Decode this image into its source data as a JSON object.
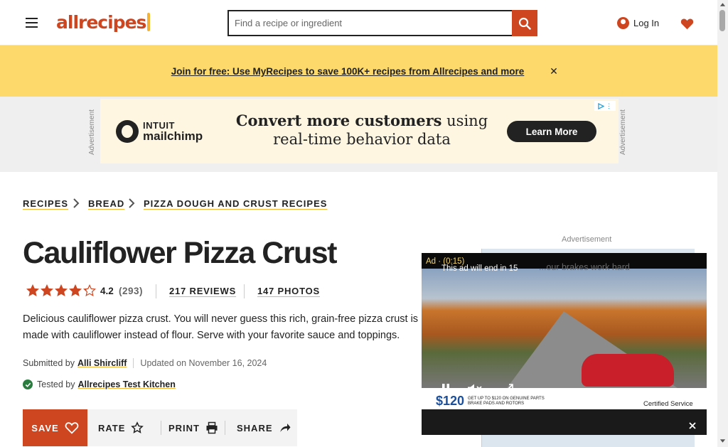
{
  "header": {
    "logo_text": "allrecipes",
    "search_placeholder": "Find a recipe or ingredient",
    "login_label": "Log In"
  },
  "promo": {
    "link_text": "Join for free: Use MyRecipes to save 100K+ recipes from Allrecipes and more",
    "close_label": "✕"
  },
  "ad": {
    "side_label": "Advertisement",
    "brand_line1": "INTUIT",
    "brand_line2": "mailchimp",
    "headline_bold": "Convert more customers",
    "headline_rest": " using real-time behavior data",
    "cta": "Learn More"
  },
  "breadcrumb": [
    {
      "label": "RECIPES"
    },
    {
      "label": "BREAD"
    },
    {
      "label": "PIZZA DOUGH AND CRUST RECIPES"
    }
  ],
  "recipe": {
    "title": "Cauliflower Pizza Crust",
    "rating_value": "4.2",
    "rating_stars": 4.2,
    "rating_count": "(293)",
    "reviews_label": "217 REVIEWS",
    "photos_label": "147 PHOTOS",
    "description": "Delicious cauliflower pizza crust. You will never guess this rich, grain-free pizza crust is made with cauliflower instead of flour. Serve with your favorite sauce and toppings.",
    "submitted_prefix": "Submitted by",
    "author": "Alli Shircliff",
    "updated": "Updated on November 16, 2024",
    "tested_prefix": "Tested by",
    "tested_by": "Allrecipes Test Kitchen"
  },
  "actions": {
    "save": "SAVE",
    "rate": "RATE",
    "print": "PRINT",
    "share": "SHARE"
  },
  "video_ad": {
    "advertisement_label": "Advertisement",
    "timer": "Ad · (0:15)",
    "ends_text": "This ad will end in 15",
    "background_text": "...our brakes work hard",
    "price": "$120",
    "price_fine": "GET UP TO $120 ON GENUINE PARTS BRAKE PADS AND ROTORS",
    "certified": "Certified Service"
  },
  "colors": {
    "brand": "#ce4620",
    "promo_bg": "#fdd86a",
    "accent_underline": "#f5b335"
  }
}
